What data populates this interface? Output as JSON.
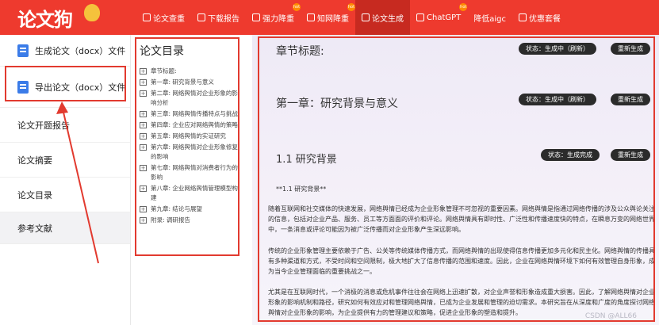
{
  "brand": {
    "logo_text": "论文狗"
  },
  "nav": [
    {
      "label": "论文查重",
      "icon": "check-doc-icon",
      "hot": false,
      "active": false
    },
    {
      "label": "下载报告",
      "icon": "download-icon",
      "hot": false,
      "active": false
    },
    {
      "label": "强力降重",
      "icon": "rewrite-icon",
      "hot": true,
      "active": false
    },
    {
      "label": "知网降重",
      "icon": "cnki-icon",
      "hot": true,
      "active": false
    },
    {
      "label": "论文生成",
      "icon": "generate-icon",
      "hot": false,
      "active": true
    },
    {
      "label": "ChatGPT",
      "icon": "chat-icon",
      "hot": true,
      "active": false
    },
    {
      "label": "降低aigc",
      "icon": "",
      "hot": false,
      "active": false
    },
    {
      "label": "优惠套餐",
      "icon": "package-icon",
      "hot": false,
      "active": false
    }
  ],
  "sidebar": {
    "items": [
      {
        "label": "生成论文（docx）文件"
      },
      {
        "label": "导出论文（docx）文件"
      },
      {
        "label": "论文开题报告"
      },
      {
        "label": "论文摘要"
      },
      {
        "label": "论文目录"
      },
      {
        "label": "参考文献"
      }
    ]
  },
  "outline": {
    "title": "论文目录",
    "items": [
      "章节标题:",
      "第一章: 研究背景与意义",
      "第二章: 网络舆情对企业形象的影响分析",
      "第三章: 网络舆情传播特点与挑战",
      "第四章: 企业应对网络舆情的策略",
      "第五章: 网络舆情的实证研究",
      "第六章: 网络舆情对企业形象修复的影响",
      "第七章: 网络舆情对消费者行为的影响",
      "第八章: 企业网络舆情管理模型构建",
      "第九章: 结论与展望",
      "附录: 调研报告"
    ]
  },
  "main": {
    "sections": [
      {
        "title": "章节标题:",
        "status": "状态：生成中（刷新）",
        "regen": "重新生成"
      },
      {
        "title": "第一章：研究背景与意义",
        "status": "状态：生成中（刷新）",
        "regen": "重新生成"
      },
      {
        "title": "1.1 研究背景",
        "status": "状态：生成完成",
        "regen": "重新生成"
      }
    ],
    "subheading": "**1.1 研究背景**",
    "paragraphs": [
      "随着互联网和社交媒体的快速发展，网络舆情已经成为企业形象管理不可忽视的重要因素。网络舆情是指通过网络传播的涉及公众舆论关注的信息，包括对企业产品、服务、员工等方面面的评价和评论。网络舆情具有即时性、广泛性和传播速度快的特点，在瞬息万变的网络世界中，一条消息或评论可能因为被广泛传播而对企业形象产生深远影响。",
      "传统的企业形象管理主要依赖于广告、公关等传统媒体传播方式，而网络舆情的出现使得信息传播更加多元化和民主化。网络舆情的传播具有多种渠道和方式，不受时间和空间限制，极大地扩大了信息传播的范围和速度。因此，企业在网络舆情环境下如何有效管理自身形象，成为当今企业管理面临的重要挑战之一。",
      "尤其是在互联网时代，一个消极的消息或危机事件往往会在网络上迅速扩散，对企业声誉和形象造成重大损害。因此，了解网络舆情对企业形象的影响机制和路径，研究如何有效应对和管理网络舆情，已成为企业发展和管理的迫切需求。本研究旨在从深度和广度的角度探讨网络舆情对企业形象的影响，为企业提供有力的管理建议和策略，促进企业形象的塑造和提升。"
    ],
    "watermark": "CSDN @ALL66"
  },
  "colors": {
    "brand_red": "#ee3a2e",
    "annotation_red": "#e23a2f",
    "badge_dark": "#2b2b2b"
  }
}
